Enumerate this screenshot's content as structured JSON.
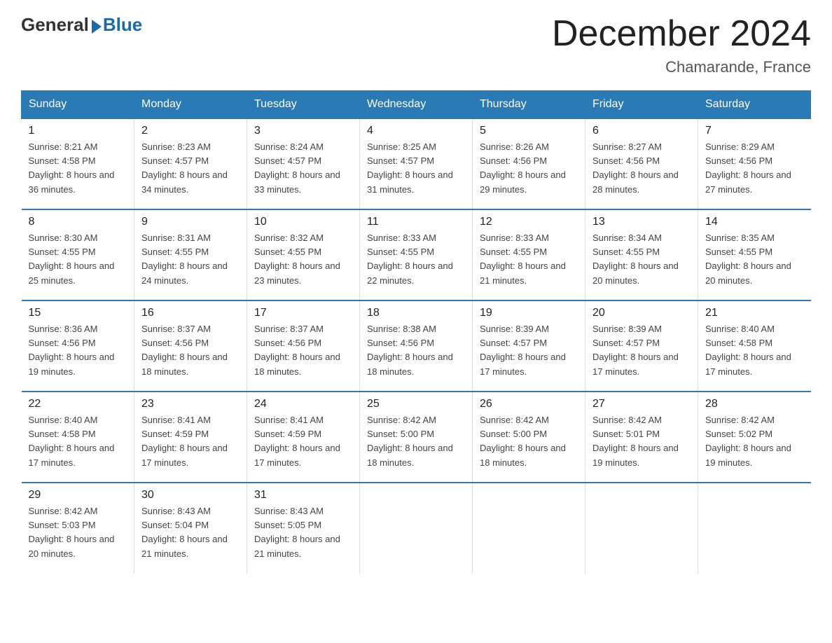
{
  "logo": {
    "general": "General",
    "blue": "Blue"
  },
  "title": "December 2024",
  "subtitle": "Chamarande, France",
  "days_of_week": [
    "Sunday",
    "Monday",
    "Tuesday",
    "Wednesday",
    "Thursday",
    "Friday",
    "Saturday"
  ],
  "weeks": [
    [
      {
        "day": "1",
        "sunrise": "Sunrise: 8:21 AM",
        "sunset": "Sunset: 4:58 PM",
        "daylight": "Daylight: 8 hours and 36 minutes."
      },
      {
        "day": "2",
        "sunrise": "Sunrise: 8:23 AM",
        "sunset": "Sunset: 4:57 PM",
        "daylight": "Daylight: 8 hours and 34 minutes."
      },
      {
        "day": "3",
        "sunrise": "Sunrise: 8:24 AM",
        "sunset": "Sunset: 4:57 PM",
        "daylight": "Daylight: 8 hours and 33 minutes."
      },
      {
        "day": "4",
        "sunrise": "Sunrise: 8:25 AM",
        "sunset": "Sunset: 4:57 PM",
        "daylight": "Daylight: 8 hours and 31 minutes."
      },
      {
        "day": "5",
        "sunrise": "Sunrise: 8:26 AM",
        "sunset": "Sunset: 4:56 PM",
        "daylight": "Daylight: 8 hours and 29 minutes."
      },
      {
        "day": "6",
        "sunrise": "Sunrise: 8:27 AM",
        "sunset": "Sunset: 4:56 PM",
        "daylight": "Daylight: 8 hours and 28 minutes."
      },
      {
        "day": "7",
        "sunrise": "Sunrise: 8:29 AM",
        "sunset": "Sunset: 4:56 PM",
        "daylight": "Daylight: 8 hours and 27 minutes."
      }
    ],
    [
      {
        "day": "8",
        "sunrise": "Sunrise: 8:30 AM",
        "sunset": "Sunset: 4:55 PM",
        "daylight": "Daylight: 8 hours and 25 minutes."
      },
      {
        "day": "9",
        "sunrise": "Sunrise: 8:31 AM",
        "sunset": "Sunset: 4:55 PM",
        "daylight": "Daylight: 8 hours and 24 minutes."
      },
      {
        "day": "10",
        "sunrise": "Sunrise: 8:32 AM",
        "sunset": "Sunset: 4:55 PM",
        "daylight": "Daylight: 8 hours and 23 minutes."
      },
      {
        "day": "11",
        "sunrise": "Sunrise: 8:33 AM",
        "sunset": "Sunset: 4:55 PM",
        "daylight": "Daylight: 8 hours and 22 minutes."
      },
      {
        "day": "12",
        "sunrise": "Sunrise: 8:33 AM",
        "sunset": "Sunset: 4:55 PM",
        "daylight": "Daylight: 8 hours and 21 minutes."
      },
      {
        "day": "13",
        "sunrise": "Sunrise: 8:34 AM",
        "sunset": "Sunset: 4:55 PM",
        "daylight": "Daylight: 8 hours and 20 minutes."
      },
      {
        "day": "14",
        "sunrise": "Sunrise: 8:35 AM",
        "sunset": "Sunset: 4:55 PM",
        "daylight": "Daylight: 8 hours and 20 minutes."
      }
    ],
    [
      {
        "day": "15",
        "sunrise": "Sunrise: 8:36 AM",
        "sunset": "Sunset: 4:56 PM",
        "daylight": "Daylight: 8 hours and 19 minutes."
      },
      {
        "day": "16",
        "sunrise": "Sunrise: 8:37 AM",
        "sunset": "Sunset: 4:56 PM",
        "daylight": "Daylight: 8 hours and 18 minutes."
      },
      {
        "day": "17",
        "sunrise": "Sunrise: 8:37 AM",
        "sunset": "Sunset: 4:56 PM",
        "daylight": "Daylight: 8 hours and 18 minutes."
      },
      {
        "day": "18",
        "sunrise": "Sunrise: 8:38 AM",
        "sunset": "Sunset: 4:56 PM",
        "daylight": "Daylight: 8 hours and 18 minutes."
      },
      {
        "day": "19",
        "sunrise": "Sunrise: 8:39 AM",
        "sunset": "Sunset: 4:57 PM",
        "daylight": "Daylight: 8 hours and 17 minutes."
      },
      {
        "day": "20",
        "sunrise": "Sunrise: 8:39 AM",
        "sunset": "Sunset: 4:57 PM",
        "daylight": "Daylight: 8 hours and 17 minutes."
      },
      {
        "day": "21",
        "sunrise": "Sunrise: 8:40 AM",
        "sunset": "Sunset: 4:58 PM",
        "daylight": "Daylight: 8 hours and 17 minutes."
      }
    ],
    [
      {
        "day": "22",
        "sunrise": "Sunrise: 8:40 AM",
        "sunset": "Sunset: 4:58 PM",
        "daylight": "Daylight: 8 hours and 17 minutes."
      },
      {
        "day": "23",
        "sunrise": "Sunrise: 8:41 AM",
        "sunset": "Sunset: 4:59 PM",
        "daylight": "Daylight: 8 hours and 17 minutes."
      },
      {
        "day": "24",
        "sunrise": "Sunrise: 8:41 AM",
        "sunset": "Sunset: 4:59 PM",
        "daylight": "Daylight: 8 hours and 17 minutes."
      },
      {
        "day": "25",
        "sunrise": "Sunrise: 8:42 AM",
        "sunset": "Sunset: 5:00 PM",
        "daylight": "Daylight: 8 hours and 18 minutes."
      },
      {
        "day": "26",
        "sunrise": "Sunrise: 8:42 AM",
        "sunset": "Sunset: 5:00 PM",
        "daylight": "Daylight: 8 hours and 18 minutes."
      },
      {
        "day": "27",
        "sunrise": "Sunrise: 8:42 AM",
        "sunset": "Sunset: 5:01 PM",
        "daylight": "Daylight: 8 hours and 19 minutes."
      },
      {
        "day": "28",
        "sunrise": "Sunrise: 8:42 AM",
        "sunset": "Sunset: 5:02 PM",
        "daylight": "Daylight: 8 hours and 19 minutes."
      }
    ],
    [
      {
        "day": "29",
        "sunrise": "Sunrise: 8:42 AM",
        "sunset": "Sunset: 5:03 PM",
        "daylight": "Daylight: 8 hours and 20 minutes."
      },
      {
        "day": "30",
        "sunrise": "Sunrise: 8:43 AM",
        "sunset": "Sunset: 5:04 PM",
        "daylight": "Daylight: 8 hours and 21 minutes."
      },
      {
        "day": "31",
        "sunrise": "Sunrise: 8:43 AM",
        "sunset": "Sunset: 5:05 PM",
        "daylight": "Daylight: 8 hours and 21 minutes."
      },
      {
        "day": "",
        "sunrise": "",
        "sunset": "",
        "daylight": ""
      },
      {
        "day": "",
        "sunrise": "",
        "sunset": "",
        "daylight": ""
      },
      {
        "day": "",
        "sunrise": "",
        "sunset": "",
        "daylight": ""
      },
      {
        "day": "",
        "sunrise": "",
        "sunset": "",
        "daylight": ""
      }
    ]
  ]
}
